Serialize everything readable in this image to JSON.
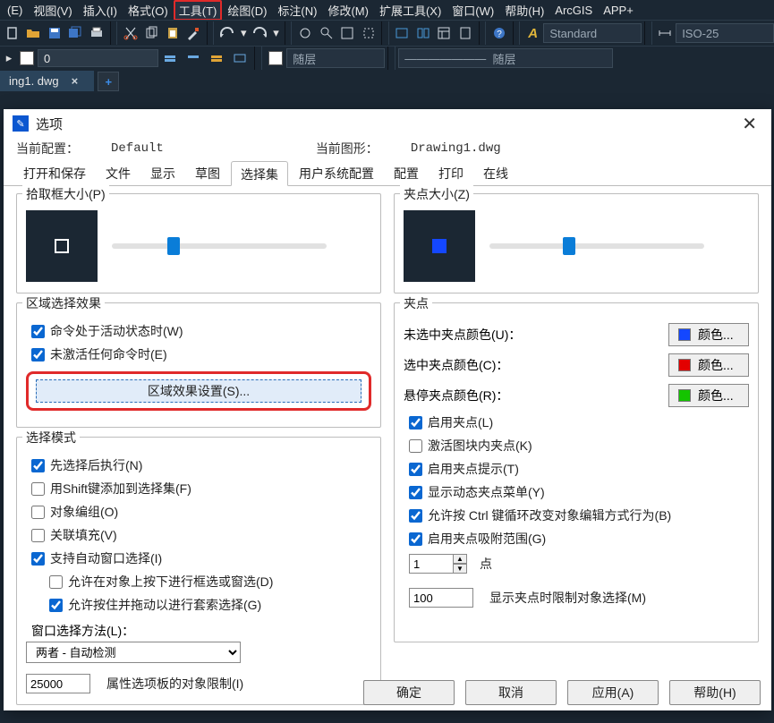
{
  "menu": {
    "items": [
      "(E)",
      "视图(V)",
      "插入(I)",
      "格式(O)",
      "工具(T)",
      "绘图(D)",
      "标注(N)",
      "修改(M)",
      "扩展工具(X)",
      "窗口(W)",
      "帮助(H)",
      "ArcGIS",
      "APP+"
    ],
    "highlight_index": 4
  },
  "toolbar": {
    "style_label": "Standard",
    "iso_label": "ISO-25",
    "layer_label_1": "0",
    "layer_label_mid": "随层",
    "layer_label_right": "随层"
  },
  "filetab": {
    "name": "ing1. dwg",
    "close_glyph": "×",
    "new_glyph": "+"
  },
  "dialog": {
    "title": "选项",
    "close_glyph": "✕",
    "current_profile_label": "当前配置：",
    "current_profile_value": "Default",
    "current_drawing_label": "当前图形：",
    "current_drawing_value": "Drawing1.dwg",
    "tabs": [
      "打开和保存",
      "文件",
      "显示",
      "草图",
      "选择集",
      "用户系统配置",
      "配置",
      "打印",
      "在线"
    ],
    "active_tab_index": 4,
    "pickbox": {
      "legend": "拾取框大小(P)"
    },
    "gripsize": {
      "legend": "夹点大小(Z)"
    },
    "region_effect": {
      "legend": "区域选择效果",
      "chk_active": "命令处于活动状态时(W)",
      "chk_none": "未激活任何命令时(E)",
      "button": "区域效果设置(S)..."
    },
    "select_mode": {
      "legend": "选择模式",
      "c1": "先选择后执行(N)",
      "c2": "用Shift键添加到选择集(F)",
      "c3": "对象编组(O)",
      "c4": "关联填充(V)",
      "c5": "支持自动窗口选择(I)",
      "c5a": "允许在对象上按下进行框选或窗选(D)",
      "c5b": "允许按住并拖动以进行套索选择(G)",
      "win_method_label": "窗口选择方法(L)：",
      "win_method_value": "两者 - 自动检测",
      "obj_limit_value": "25000",
      "obj_limit_label": "属性选项板的对象限制(I)"
    },
    "grips": {
      "legend": "夹点",
      "row1_label": "未选中夹点颜色(U)：",
      "row2_label": "选中夹点颜色(C)：",
      "row3_label": "悬停夹点颜色(R)：",
      "color_btn": "颜色...",
      "sw1": "#1447ff",
      "sw2": "#e30000",
      "sw3": "#14c400",
      "chk1": "启用夹点(L)",
      "chk2": "激活图块内夹点(K)",
      "chk3": "启用夹点提示(T)",
      "chk4": "显示动态夹点菜单(Y)",
      "chk5": "允许按 Ctrl 键循环改变对象编辑方式行为(B)",
      "chk6": "启用夹点吸附范围(G)",
      "spin_value": "1",
      "spin_label": "点",
      "limit_value": "100",
      "limit_label": "显示夹点时限制对象选择(M)"
    },
    "buttons": {
      "ok": "确定",
      "cancel": "取消",
      "apply": "应用(A)",
      "help": "帮助(H)"
    }
  }
}
